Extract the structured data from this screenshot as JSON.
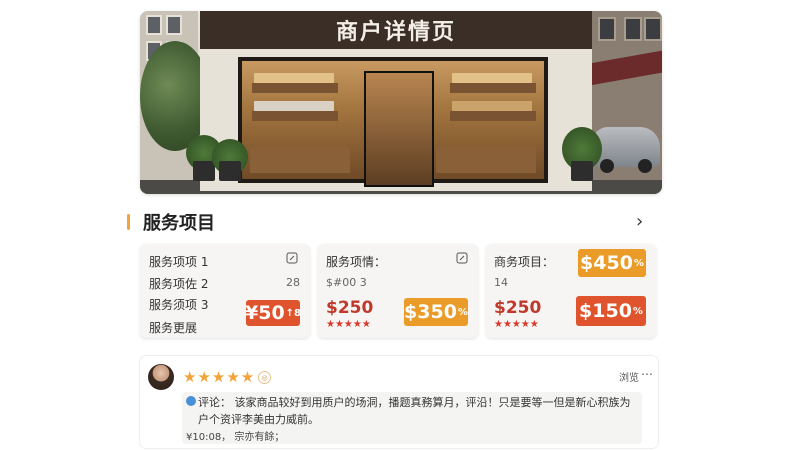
{
  "hero": {
    "sign_text": "商户详情页"
  },
  "services": {
    "title": "服务项目",
    "cards": [
      {
        "items": [
          "服务项项 1",
          "服务项佐 2",
          "服务须项 3",
          "服务更展"
        ],
        "edit_value": "28",
        "price_tag": {
          "amount": "¥50",
          "suffix": "↑8",
          "color": "#e0542d"
        }
      },
      {
        "title": "服务项情：",
        "subtitle": "$#00 3",
        "price": "$250",
        "stars": "★★★★★",
        "price_tag": {
          "amount": "$350",
          "suffix": "%",
          "color": "#eb9b27"
        }
      },
      {
        "title": "商务项目：",
        "subtitle": "14",
        "price": "$250",
        "stars": "★★★★★",
        "top_tag": {
          "amount": "$450",
          "suffix": "%",
          "color": "#eb9b27"
        },
        "price_tag": {
          "amount": "$150",
          "suffix": "%",
          "color": "#e0542d"
        }
      }
    ]
  },
  "review": {
    "stars": "★★★★★",
    "badge": "◎",
    "meta": "浏览",
    "more": "⋯",
    "text": "评论：  该家商品较好到用质户的场洞，播题真務算月，评沿！只是要等一但是新心积族为户个资评李美由力威前。",
    "time": "¥10:08， 宗亦有餘；"
  },
  "colors": {
    "accent": "#f0a43b",
    "price_red": "#c0392b"
  }
}
